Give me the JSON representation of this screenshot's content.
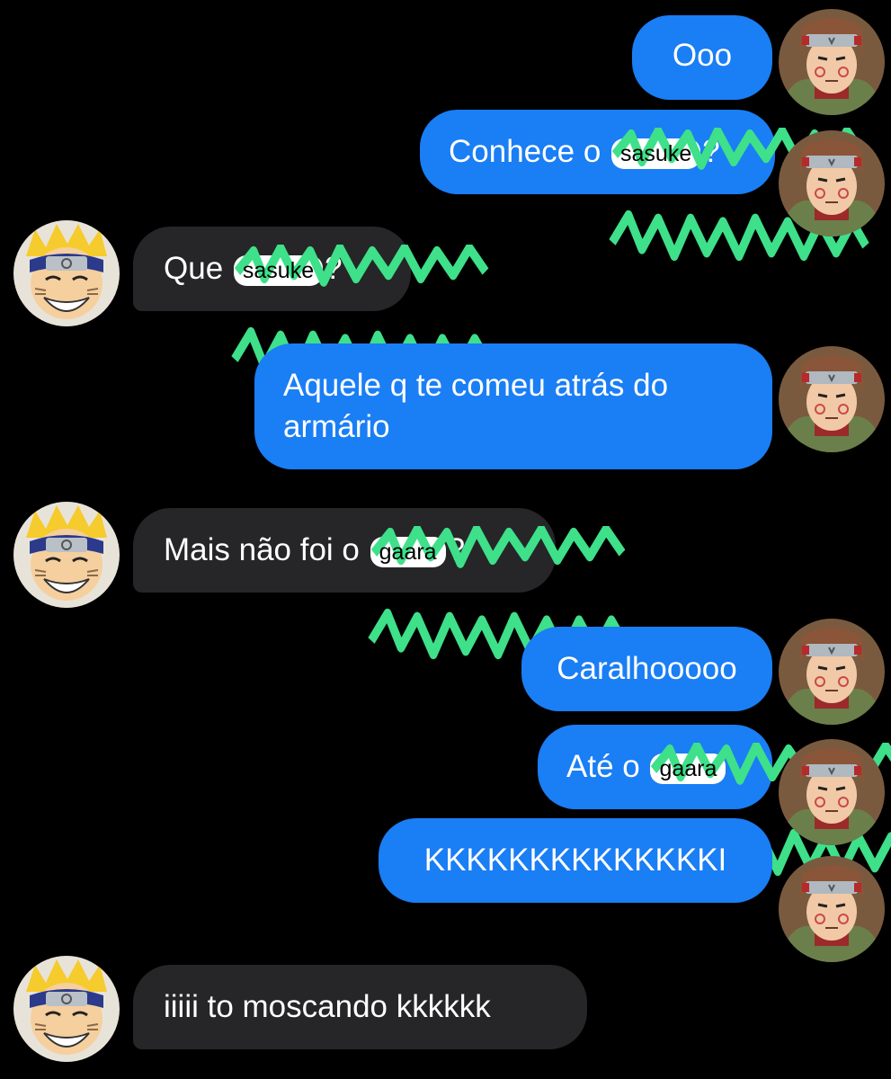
{
  "messages": [
    {
      "from": "me",
      "text": "Ooo"
    },
    {
      "from": "me",
      "prefix": "Conhece o",
      "sticker": "sasuke",
      "suffix": "?"
    },
    {
      "from": "them",
      "prefix": "Que",
      "sticker": "sasuke",
      "suffix": "?"
    },
    {
      "from": "me",
      "text": "Aquele q te comeu atrás do armário"
    },
    {
      "from": "them",
      "prefix": "Mais não foi o",
      "sticker": "gaara",
      "suffix": "?"
    },
    {
      "from": "me",
      "text": "Caralhooooo"
    },
    {
      "from": "me",
      "prefix": "Até o",
      "sticker": "gaara",
      "suffix": ""
    },
    {
      "from": "me",
      "text": "KKKKKKKKKKKKKKI"
    },
    {
      "from": "them",
      "text": "iiiii to moscando kkkkkk"
    }
  ],
  "colors": {
    "background": "#000000",
    "outgoing_bubble": "#1a7ef5",
    "incoming_bubble": "#262628",
    "scribble": "#3ee08a"
  }
}
